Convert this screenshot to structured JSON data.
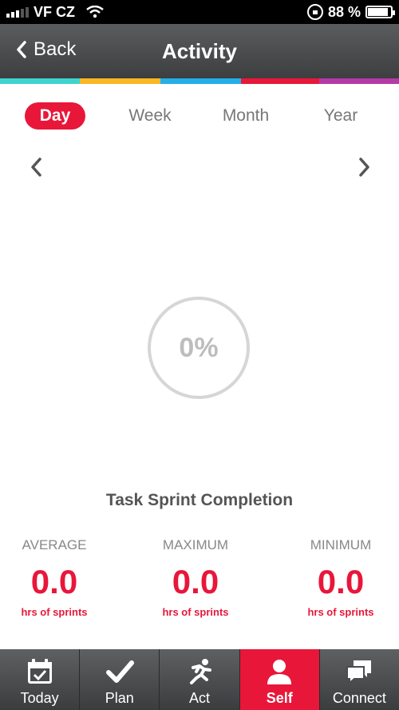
{
  "status_bar": {
    "carrier": "VF CZ",
    "battery_percent": "88 %",
    "battery_level": 0.88
  },
  "nav": {
    "back_label": "Back",
    "title": "Activity"
  },
  "color_strip": [
    "#3fd3d0",
    "#f9b823",
    "#26aee6",
    "#e8173a",
    "#b43aa8"
  ],
  "periods": [
    {
      "label": "Day",
      "active": true
    },
    {
      "label": "Week",
      "active": false
    },
    {
      "label": "Month",
      "active": false
    },
    {
      "label": "Year",
      "active": false
    }
  ],
  "ring": {
    "value_text": "0%",
    "progress": 0
  },
  "section_title": "Task Sprint Completion",
  "stats": [
    {
      "label": "AVERAGE",
      "value": "0.0",
      "unit": "hrs of sprints"
    },
    {
      "label": "MAXIMUM",
      "value": "0.0",
      "unit": "hrs of sprints"
    },
    {
      "label": "MINIMUM",
      "value": "0.0",
      "unit": "hrs of sprints"
    }
  ],
  "tab_bar": [
    {
      "label": "Today",
      "icon": "calendar-check-icon",
      "active": false
    },
    {
      "label": "Plan",
      "icon": "checkmark-icon",
      "active": false
    },
    {
      "label": "Act",
      "icon": "runner-icon",
      "active": false
    },
    {
      "label": "Self",
      "icon": "person-icon",
      "active": true
    },
    {
      "label": "Connect",
      "icon": "chat-bubbles-icon",
      "active": false
    }
  ],
  "colors": {
    "accent": "#e8173a",
    "muted_text": "#777777",
    "ring_gray": "#d6d6d6"
  }
}
